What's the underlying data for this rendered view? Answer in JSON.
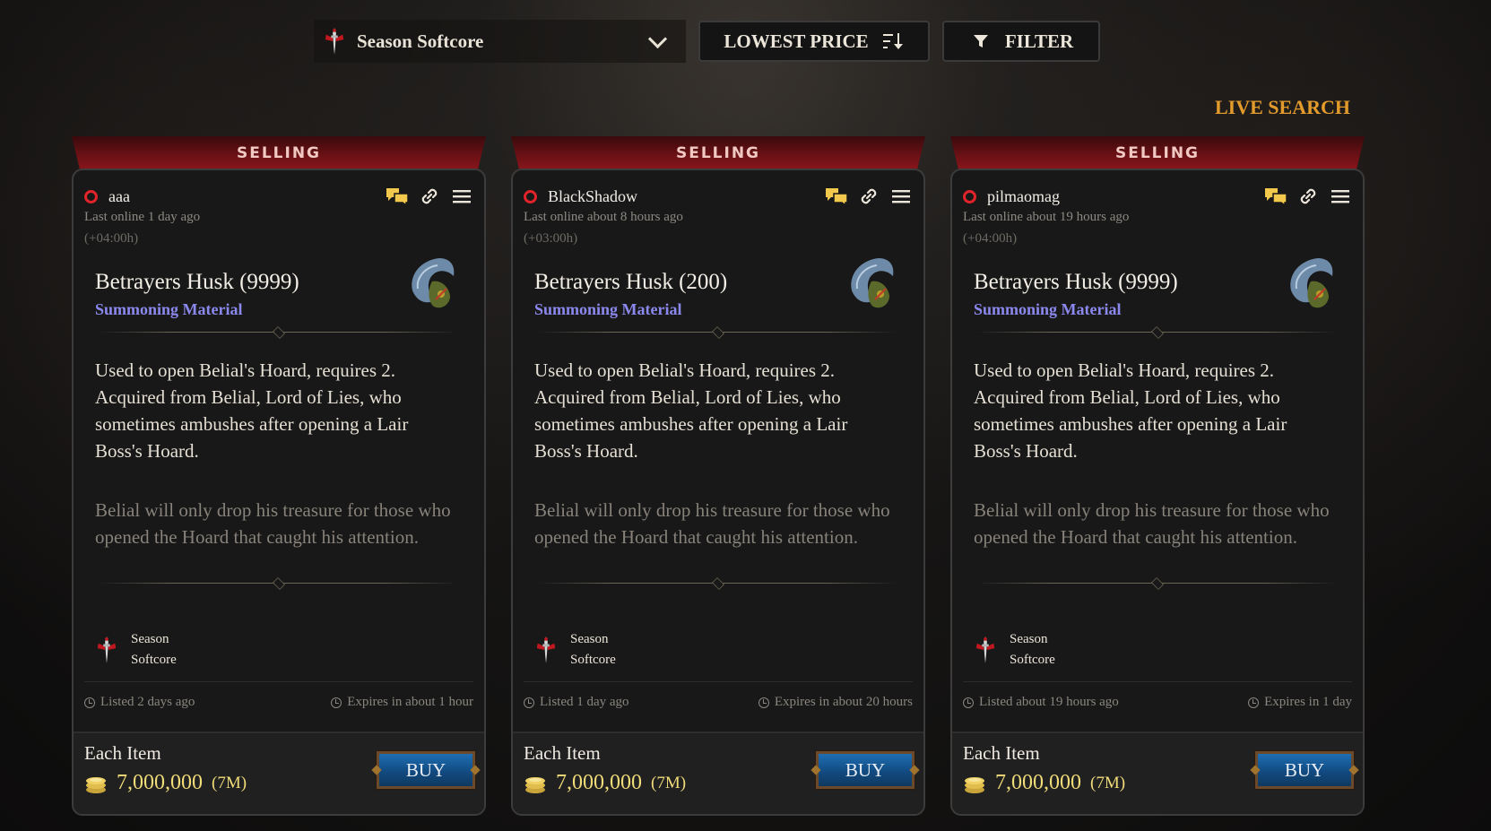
{
  "toolbar": {
    "realm": "Season Softcore",
    "sort_label": "LOWEST PRICE",
    "filter_label": "FILTER",
    "live_search": "LIVE SEARCH"
  },
  "colors": {
    "accent_gold": "#e39b2b",
    "item_type": "#8b88ee",
    "price": "#f1dc7a",
    "status_red": "#e0242a"
  },
  "icons": [
    "realm-sword-icon",
    "chevron-down-icon",
    "sort-icon",
    "funnel-icon",
    "chat-icon",
    "link-icon",
    "menu-icon",
    "clock-icon",
    "gold-coins-icon"
  ],
  "listings": [
    {
      "ribbon": "SELLING",
      "seller": "aaa",
      "last_online": "Last online 1 day ago",
      "timezone": "(+04:00h)",
      "item_name": "Betrayers Husk (9999)",
      "item_type": "Summoning Material",
      "description": "Used to open Belial's Hoard, requires 2. Acquired from Belial, Lord of Lies, who sometimes ambushes after opening a Lair Boss's Hoard.",
      "flavor": "Belial will only drop his treasure for those who opened the Hoard that caught his attention.",
      "realm_line1": "Season",
      "realm_line2": "Softcore",
      "listed": "Listed 2 days ago",
      "expires": "Expires in about 1 hour",
      "each_label": "Each Item",
      "price": "7,000,000",
      "price_short": "(7M)",
      "buy_label": "BUY"
    },
    {
      "ribbon": "SELLING",
      "seller": "BlackShadow",
      "last_online": "Last online about 8 hours ago",
      "timezone": "(+03:00h)",
      "item_name": "Betrayers Husk (200)",
      "item_type": "Summoning Material",
      "description": "Used to open Belial's Hoard, requires 2. Acquired from Belial, Lord of Lies, who sometimes ambushes after opening a Lair Boss's Hoard.",
      "flavor": "Belial will only drop his treasure for those who opened the Hoard that caught his attention.",
      "realm_line1": "Season",
      "realm_line2": "Softcore",
      "listed": "Listed 1 day ago",
      "expires": "Expires in about 20 hours",
      "each_label": "Each Item",
      "price": "7,000,000",
      "price_short": "(7M)",
      "buy_label": "BUY"
    },
    {
      "ribbon": "SELLING",
      "seller": "pilmaomag",
      "last_online": "Last online about 19 hours ago",
      "timezone": "(+04:00h)",
      "item_name": "Betrayers Husk (9999)",
      "item_type": "Summoning Material",
      "description": "Used to open Belial's Hoard, requires 2. Acquired from Belial, Lord of Lies, who sometimes ambushes after opening a Lair Boss's Hoard.",
      "flavor": "Belial will only drop his treasure for those who opened the Hoard that caught his attention.",
      "realm_line1": "Season",
      "realm_line2": "Softcore",
      "listed": "Listed about 19 hours ago",
      "expires": "Expires in 1 day",
      "each_label": "Each Item",
      "price": "7,000,000",
      "price_short": "(7M)",
      "buy_label": "BUY"
    }
  ]
}
